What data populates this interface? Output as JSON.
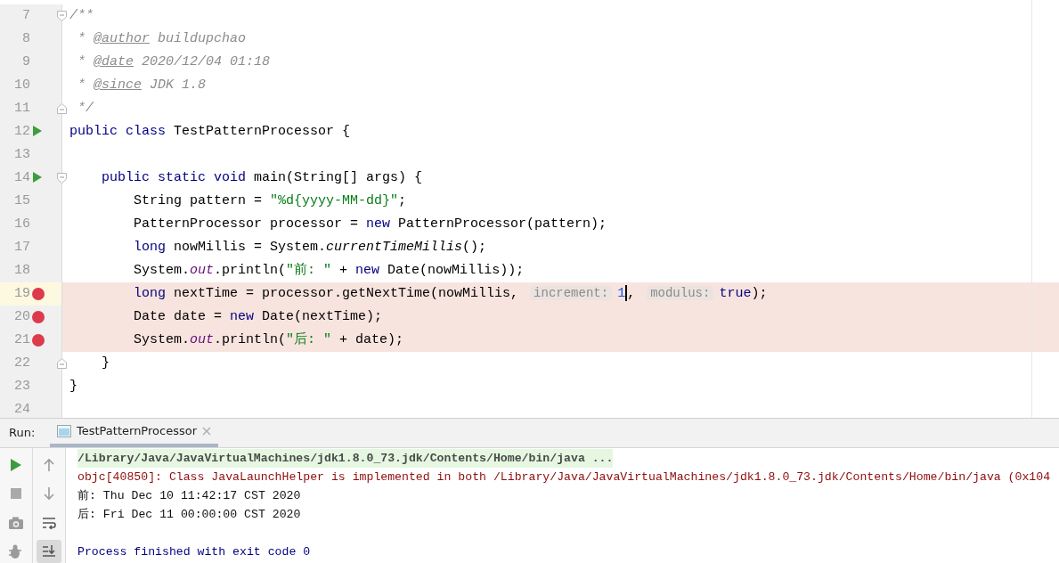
{
  "editor": {
    "lines": [
      {
        "number": "7",
        "current": false,
        "fold": {
          "kind": "start"
        },
        "tokens": [
          {
            "text": "/**",
            "kind": "comment"
          }
        ]
      },
      {
        "number": "8",
        "current": false,
        "tokens": [
          {
            "text": " * ",
            "kind": "comment"
          },
          {
            "text": "@author",
            "kind": "doc_tag"
          },
          {
            "text": " buildupchao",
            "kind": "comment"
          }
        ]
      },
      {
        "number": "9",
        "current": false,
        "tokens": [
          {
            "text": " * ",
            "kind": "comment"
          },
          {
            "text": "@date",
            "kind": "doc_tag"
          },
          {
            "text": " 2020/12/04 01:18",
            "kind": "comment"
          }
        ]
      },
      {
        "number": "10",
        "current": false,
        "tokens": [
          {
            "text": " * ",
            "kind": "comment"
          },
          {
            "text": "@since",
            "kind": "doc_tag"
          },
          {
            "text": " JDK 1.8",
            "kind": "comment"
          }
        ]
      },
      {
        "number": "11",
        "current": false,
        "fold": {
          "kind": "end"
        },
        "tokens": [
          {
            "text": " */",
            "kind": "comment"
          }
        ]
      },
      {
        "number": "12",
        "current": false,
        "marker": {
          "kind": "run"
        },
        "tokens": [
          {
            "text": "public class",
            "kind": "keyword"
          },
          {
            "text": " TestPatternProcessor {",
            "kind": "plain"
          }
        ]
      },
      {
        "number": "13",
        "current": false
      },
      {
        "number": "14",
        "current": false,
        "marker": {
          "kind": "run"
        },
        "fold": {
          "kind": "start"
        },
        "tokens": [
          {
            "text": "    public static void",
            "kind": "keyword"
          },
          {
            "text": " main(String[] args) {",
            "kind": "plain"
          }
        ]
      },
      {
        "number": "15",
        "current": false,
        "tokens": [
          {
            "text": "        String pattern = ",
            "kind": "plain"
          },
          {
            "text": "\"%d{yyyy-MM-dd}\"",
            "kind": "string"
          },
          {
            "text": ";",
            "kind": "plain"
          }
        ]
      },
      {
        "number": "16",
        "current": false,
        "tokens": [
          {
            "text": "        PatternProcessor processor = ",
            "kind": "plain"
          },
          {
            "text": "new",
            "kind": "keyword"
          },
          {
            "text": " PatternProcessor(pattern);",
            "kind": "plain"
          }
        ]
      },
      {
        "number": "17",
        "current": false,
        "tokens": [
          {
            "text": "        long",
            "kind": "keyword"
          },
          {
            "text": " nowMillis = System.",
            "kind": "plain"
          },
          {
            "text": "currentTimeMillis",
            "kind": "static_call"
          },
          {
            "text": "();",
            "kind": "plain"
          }
        ]
      },
      {
        "number": "18",
        "current": false,
        "tokens": [
          {
            "text": "        System.",
            "kind": "plain"
          },
          {
            "text": "out",
            "kind": "static_field"
          },
          {
            "text": ".println(",
            "kind": "plain"
          },
          {
            "text": "\"前: \"",
            "kind": "string"
          },
          {
            "text": " + ",
            "kind": "plain"
          },
          {
            "text": "new",
            "kind": "keyword"
          },
          {
            "text": " Date(nowMillis));",
            "kind": "plain"
          }
        ]
      },
      {
        "number": "19",
        "current": true,
        "marker": {
          "kind": "breakpoint"
        },
        "tokens": [
          {
            "text": "        long",
            "kind": "keyword"
          },
          {
            "text": " nextTime = processor.getNextTime(nowMillis, ",
            "kind": "plain"
          },
          {
            "text": "increment:",
            "kind": "hint"
          },
          {
            "text": "1",
            "kind": "number",
            "caret": true
          },
          {
            "text": ", ",
            "kind": "plain"
          },
          {
            "text": "modulus:",
            "kind": "hint"
          },
          {
            "text": "true",
            "kind": "keyword"
          },
          {
            "text": ");",
            "kind": "plain"
          }
        ]
      },
      {
        "number": "20",
        "current": false,
        "marker": {
          "kind": "breakpoint"
        },
        "tokens": [
          {
            "text": "        Date date = ",
            "kind": "plain"
          },
          {
            "text": "new",
            "kind": "keyword"
          },
          {
            "text": " Date(nextTime);",
            "kind": "plain"
          }
        ]
      },
      {
        "number": "21",
        "current": false,
        "marker": {
          "kind": "breakpoint"
        },
        "tokens": [
          {
            "text": "        System.",
            "kind": "plain"
          },
          {
            "text": "out",
            "kind": "static_field"
          },
          {
            "text": ".println(",
            "kind": "plain"
          },
          {
            "text": "\"后: \"",
            "kind": "string"
          },
          {
            "text": " + date);",
            "kind": "plain"
          }
        ]
      },
      {
        "number": "22",
        "current": false,
        "fold": {
          "kind": "end"
        },
        "tokens": [
          {
            "text": "    }",
            "kind": "plain"
          }
        ]
      },
      {
        "number": "23",
        "current": false,
        "tokens": [
          {
            "text": "}",
            "kind": "plain"
          }
        ]
      },
      {
        "number": "24",
        "current": false
      }
    ]
  },
  "run_panel": {
    "label": "Run:",
    "tabs": [
      {
        "label": "TestPatternProcessor",
        "selected": true
      }
    ],
    "toolbar": {
      "soft_wrap_on": false,
      "scroll_to_end_on": true
    },
    "console": [
      {
        "text": "/Library/Java/JavaVirtualMachines/jdk1.8.0_73.jdk/Contents/Home/bin/java ...",
        "kind": "command"
      },
      {
        "text": "objc[40850]: Class JavaLaunchHelper is implemented in both /Library/Java/JavaVirtualMachines/jdk1.8.0_73.jdk/Contents/Home/bin/java (0x104",
        "kind": "error"
      },
      {
        "text": "前: Thu Dec 10 11:42:17 CST 2020",
        "kind": "output"
      },
      {
        "text": "后: Fri Dec 11 00:00:00 CST 2020",
        "kind": "output"
      },
      {
        "text": "Process finished with exit code 0",
        "kind": "exit"
      }
    ]
  }
}
